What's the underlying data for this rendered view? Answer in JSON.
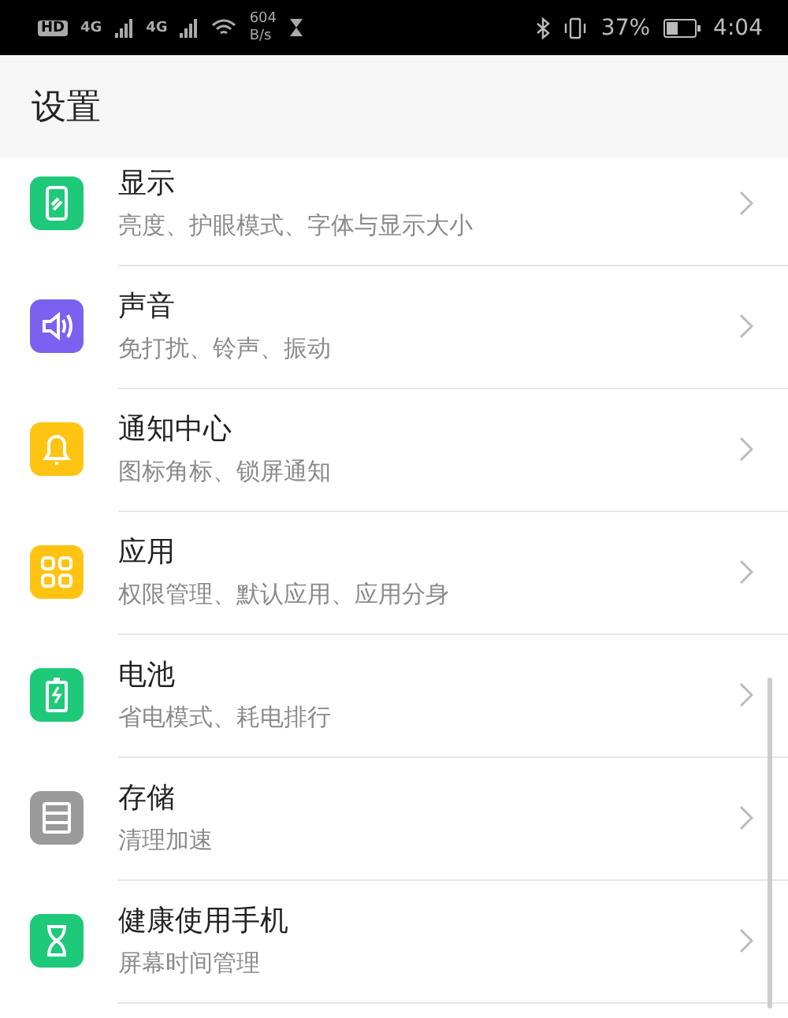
{
  "status_bar": {
    "left": [
      "HD",
      "4G",
      "4G"
    ],
    "speed": [
      "604",
      "B/s"
    ],
    "battery_percent": "37%",
    "time": "4:04"
  },
  "header": {
    "title": "设置"
  },
  "settings": [
    {
      "title": "显示",
      "subtitle": "亮度、护眼模式、字体与显示大小",
      "color": "#1ec97a"
    },
    {
      "title": "声音",
      "subtitle": "免打扰、铃声、振动",
      "color": "#7b61f0"
    },
    {
      "title": "通知中心",
      "subtitle": "图标角标、锁屏通知",
      "color": "#ffc412"
    },
    {
      "title": "应用",
      "subtitle": "权限管理、默认应用、应用分身",
      "color": "#ffc412"
    },
    {
      "title": "电池",
      "subtitle": "省电模式、耗电排行",
      "color": "#1ec97a"
    },
    {
      "title": "存储",
      "subtitle": "清理加速",
      "color": "#9a9a9a"
    },
    {
      "title": "健康使用手机",
      "subtitle": "屏幕时间管理",
      "color": "#1ec97a"
    }
  ]
}
